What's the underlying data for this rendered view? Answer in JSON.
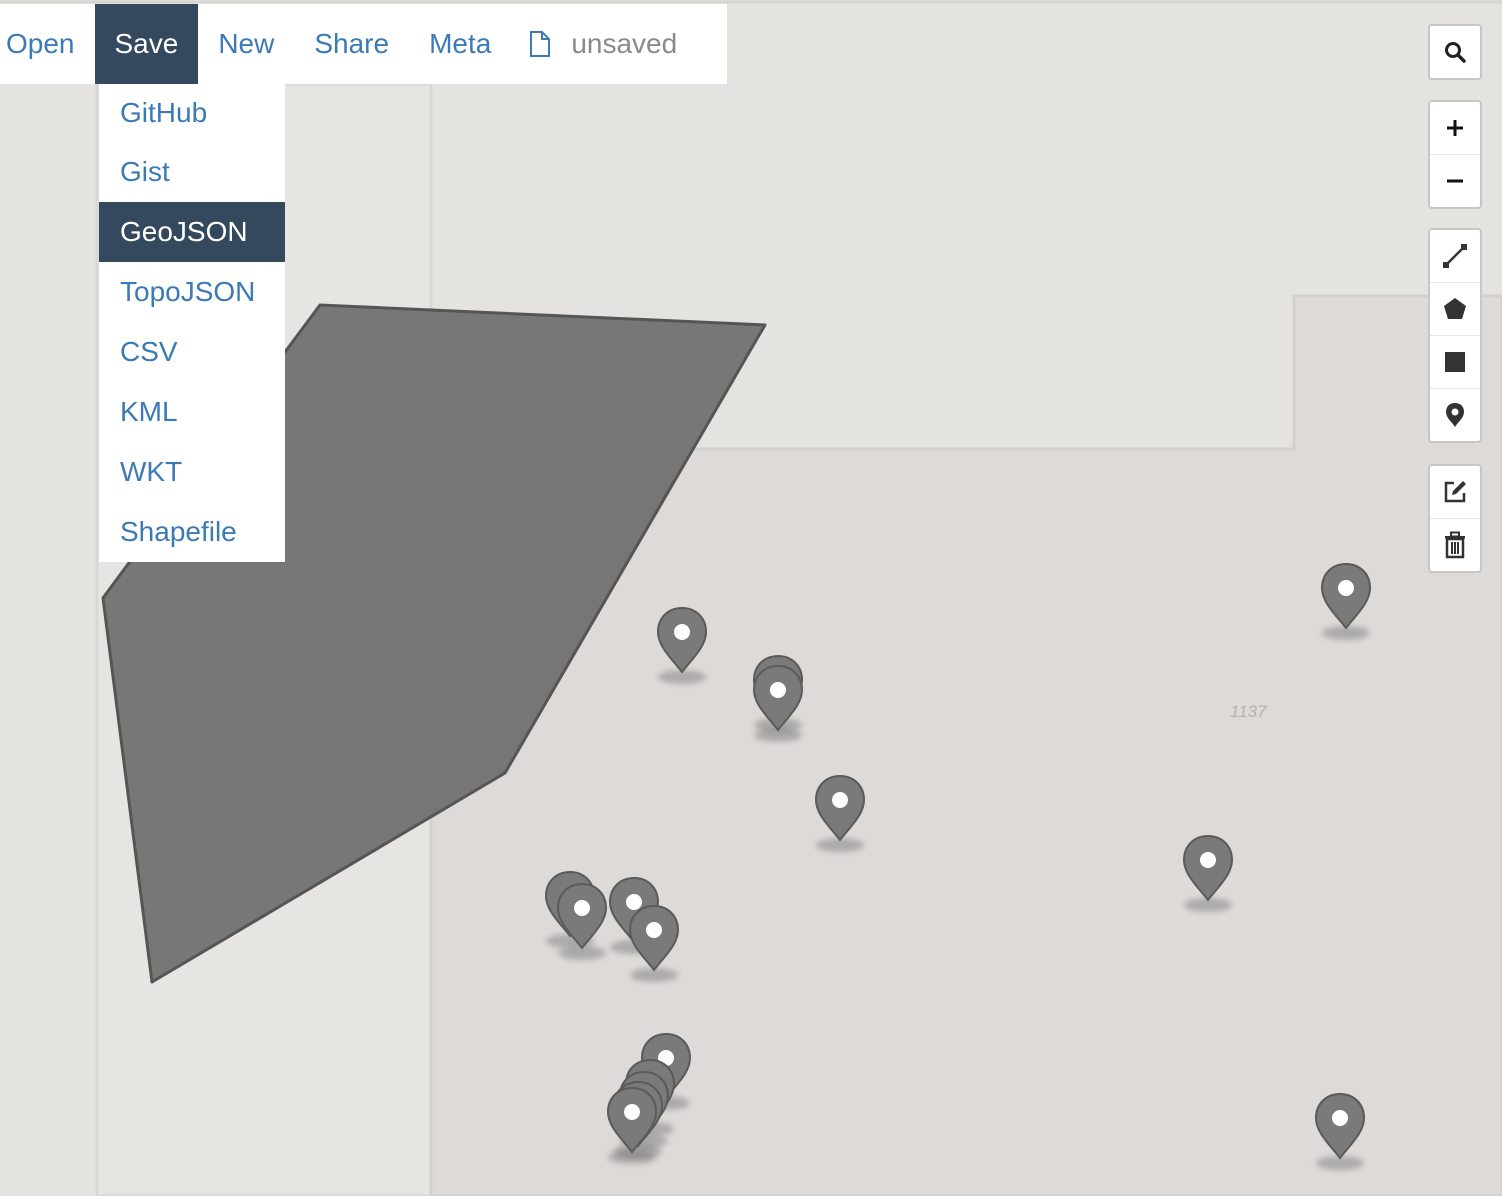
{
  "menu": {
    "items": [
      {
        "label": "Open"
      },
      {
        "label": "Save"
      },
      {
        "label": "New"
      },
      {
        "label": "Share"
      },
      {
        "label": "Meta"
      }
    ],
    "active": "Save",
    "status_icon": "file-icon",
    "status_text": "unsaved"
  },
  "save_dropdown": {
    "items": [
      {
        "label": "GitHub"
      },
      {
        "label": "Gist"
      },
      {
        "label": "GeoJSON"
      },
      {
        "label": "TopoJSON"
      },
      {
        "label": "CSV"
      },
      {
        "label": "KML"
      },
      {
        "label": "WKT"
      },
      {
        "label": "Shapefile"
      }
    ],
    "highlighted": "GeoJSON"
  },
  "map": {
    "parcel_label": "1137",
    "feature_color": "#6e6e6c",
    "marker_count": 18
  },
  "controls": {
    "search": {
      "icon": "search-icon"
    },
    "zoom": [
      {
        "icon": "plus-icon",
        "label": "+"
      },
      {
        "icon": "minus-icon",
        "label": "−"
      }
    ],
    "draw": [
      "polyline-icon",
      "polygon-icon",
      "rectangle-icon",
      "marker-icon"
    ],
    "edit": [
      "edit-icon",
      "trash-icon"
    ]
  },
  "colors": {
    "menu_active_bg": "#34495e",
    "link": "#3c7ab5",
    "map_bg": "#e4e3df"
  }
}
